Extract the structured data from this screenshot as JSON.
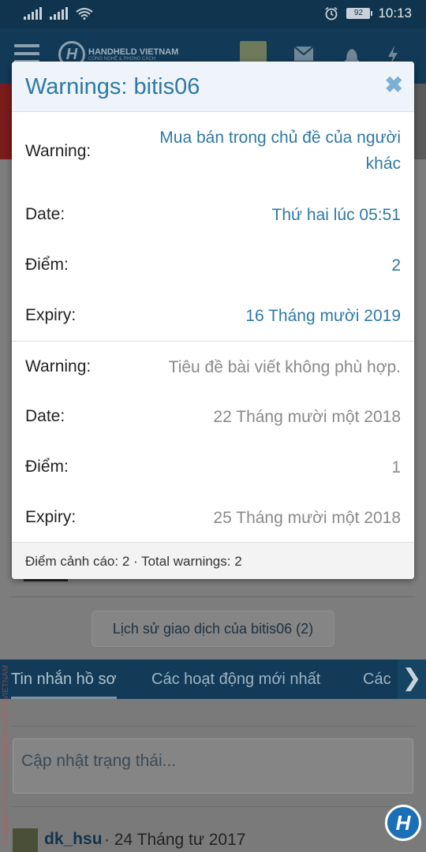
{
  "status_bar": {
    "time": "10:13",
    "battery": "92",
    "icons": [
      "signal-icon",
      "signal-icon",
      "wifi-icon",
      "alarm-icon",
      "battery-icon"
    ]
  },
  "header": {
    "logo_text": "HANDHELD VIETNAM",
    "logo_subtext": "CÔNG NGHỆ & PHONG CÁCH",
    "logo_letter": "H",
    "icons": [
      "menu-icon",
      "avatar",
      "mail-icon",
      "bell-icon",
      "flash-icon"
    ]
  },
  "modal": {
    "title": "Warnings: bitis06",
    "close_glyph": "✖",
    "warnings": [
      {
        "warning_label": "Warning:",
        "warning_value": "Mua bán trong chủ đề của người khác",
        "date_label": "Date:",
        "date_value": "Thứ hai lúc 05:51",
        "points_label": "Điểm:",
        "points_value": "2",
        "expiry_label": "Expiry:",
        "expiry_value": "16 Tháng mười 2019",
        "state": "active"
      },
      {
        "warning_label": "Warning:",
        "warning_value": "Tiêu đề bài viết không phù hợp.",
        "date_label": "Date:",
        "date_value": "22 Tháng mười một 2018",
        "points_label": "Điểm:",
        "points_value": "1",
        "expiry_label": "Expiry:",
        "expiry_value": "25 Tháng mười một 2018",
        "state": "expired"
      }
    ],
    "footer": "Điểm cảnh cáo: 2 · Total warnings: 2"
  },
  "background": {
    "history_button": "Lịch sử giao dịch của bitis06 (2)",
    "tabs": [
      "Tin nhắn hồ sơ",
      "Các hoạt động mới nhất",
      "Các"
    ],
    "tab_next_glyph": "❯",
    "status_placeholder": "Cập nhật trạng thái...",
    "post_author": "dk_hsu",
    "post_date": "· 24 Tháng tư 2017",
    "watermark": "Copyright©2018 by bitis06@HANDHELDVIETNAM"
  },
  "colors": {
    "accent": "#2f79a6",
    "header_bg": "#10344d",
    "expired_text": "#8a8a8a"
  }
}
